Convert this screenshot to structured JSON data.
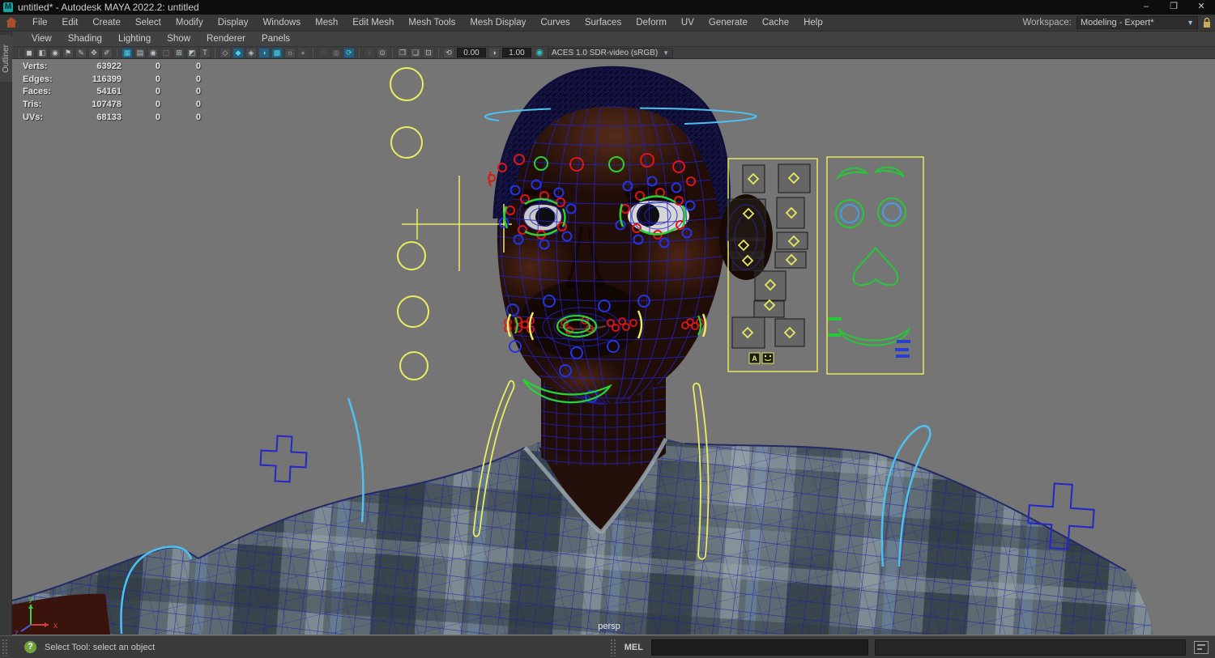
{
  "window": {
    "title": "untitled* - Autodesk MAYA 2022.2: untitled",
    "logo_letter": "M",
    "minimize": "–",
    "maximize": "❐",
    "close": "✕"
  },
  "menu_bar": {
    "items": [
      "File",
      "Edit",
      "Create",
      "Select",
      "Modify",
      "Display",
      "Windows",
      "Mesh",
      "Edit Mesh",
      "Mesh Tools",
      "Mesh Display",
      "Curves",
      "Surfaces",
      "Deform",
      "UV",
      "Generate",
      "Cache",
      "Help"
    ],
    "workspace_label": "Workspace:",
    "workspace_value": "Modeling - Expert*"
  },
  "outliner_tab": "Outliner",
  "panel_menu": {
    "items": [
      "View",
      "Shading",
      "Lighting",
      "Show",
      "Renderer",
      "Panels"
    ]
  },
  "toolbar": {
    "items": [
      {
        "type": "sep"
      },
      {
        "type": "icon",
        "name": "select-camera-icon",
        "glyph": "◼"
      },
      {
        "type": "icon",
        "name": "lock-camera-icon",
        "glyph": "◧"
      },
      {
        "type": "icon",
        "name": "camera-attributes-icon",
        "glyph": "◉"
      },
      {
        "type": "icon",
        "name": "bookmark-icon",
        "glyph": "⚑"
      },
      {
        "type": "icon",
        "name": "grease-pencil-icon",
        "glyph": "✎"
      },
      {
        "type": "icon",
        "name": "move-pivot-icon",
        "glyph": "✥"
      },
      {
        "type": "icon",
        "name": "sculpt-icon",
        "glyph": "✐"
      },
      {
        "type": "sep"
      },
      {
        "type": "icon",
        "name": "grid-icon",
        "glyph": "▦",
        "active": true
      },
      {
        "type": "icon",
        "name": "film-gate-icon",
        "glyph": "▤"
      },
      {
        "type": "icon",
        "name": "resolution-gate-icon",
        "glyph": "◉"
      },
      {
        "type": "icon",
        "name": "gate-mask-icon",
        "glyph": "▢",
        "dim": true
      },
      {
        "type": "icon",
        "name": "field-chart-icon",
        "glyph": "⊞"
      },
      {
        "type": "icon",
        "name": "safe-action-icon",
        "glyph": "◩"
      },
      {
        "type": "icon",
        "name": "safe-title-icon",
        "glyph": "T"
      },
      {
        "type": "sep"
      },
      {
        "type": "icon",
        "name": "wireframe-display-icon",
        "glyph": "◇"
      },
      {
        "type": "icon",
        "name": "shaded-display-icon",
        "glyph": "◆",
        "active": true
      },
      {
        "type": "icon",
        "name": "wireframe-on-shaded-icon",
        "glyph": "◈"
      },
      {
        "type": "icon",
        "name": "textured-display-icon",
        "glyph": "◑",
        "active": true
      },
      {
        "type": "icon",
        "name": "use-default-material-icon",
        "glyph": "▩",
        "active": true
      },
      {
        "type": "icon",
        "name": "lighting-icon",
        "glyph": "☼"
      },
      {
        "type": "icon",
        "name": "shadows-icon",
        "glyph": "●",
        "dim": true
      },
      {
        "type": "sep"
      },
      {
        "type": "icon",
        "name": "occlusion-icon",
        "glyph": "◌",
        "dim": true
      },
      {
        "type": "icon",
        "name": "motion-blur-icon",
        "glyph": "◍",
        "dim": true
      },
      {
        "type": "icon",
        "name": "anti-alias-icon",
        "glyph": "⟳",
        "active": true
      },
      {
        "type": "sep"
      },
      {
        "type": "icon",
        "name": "isolate-select-icon",
        "glyph": "▫",
        "dim": true
      },
      {
        "type": "icon",
        "name": "selection-highlight-icon",
        "glyph": "⊙"
      },
      {
        "type": "sep"
      },
      {
        "type": "icon",
        "name": "image-plane-icon",
        "glyph": "❐"
      },
      {
        "type": "icon",
        "name": "texture-placement-icon",
        "glyph": "❏"
      },
      {
        "type": "icon",
        "name": "snapshot-icon",
        "glyph": "⊡"
      },
      {
        "type": "sep"
      },
      {
        "type": "icon",
        "name": "exposure-icon",
        "glyph": "⟲"
      },
      {
        "type": "field",
        "name": "exposure-field",
        "value": "0.00"
      },
      {
        "type": "icon",
        "name": "gamma-icon",
        "glyph": "◑"
      },
      {
        "type": "field",
        "name": "gamma-field",
        "value": "1.00"
      },
      {
        "type": "icon",
        "name": "color-management-icon",
        "glyph": "◉",
        "teal": true
      }
    ],
    "color_space": "ACES 1.0 SDR-video (sRGB)"
  },
  "hud": {
    "rows": [
      {
        "label": "Verts:",
        "total": "63922",
        "sel": "0",
        "sel2": "0"
      },
      {
        "label": "Edges:",
        "total": "116399",
        "sel": "0",
        "sel2": "0"
      },
      {
        "label": "Faces:",
        "total": "54161",
        "sel": "0",
        "sel2": "0"
      },
      {
        "label": "Tris:",
        "total": "107478",
        "sel": "0",
        "sel2": "0"
      },
      {
        "label": "UVs:",
        "total": "68133",
        "sel": "0",
        "sel2": "0"
      }
    ]
  },
  "viewport": {
    "camera_label": "persp",
    "axis": {
      "x": "x",
      "y": "y",
      "z": "z"
    }
  },
  "status_bar": {
    "help_text": "Select Tool: select an object",
    "mel_label": "MEL",
    "command_value": ""
  },
  "colors": {
    "viewport_bg": "#757575",
    "wireframe_blue": "#2323c0",
    "rig_yellow": "#ecec60",
    "rig_green": "#27d233",
    "rig_red": "#e01616",
    "rig_blue": "#2335e0",
    "rig_cyan": "#4cc2f1",
    "active_toolbar": "#2a5d7c"
  }
}
